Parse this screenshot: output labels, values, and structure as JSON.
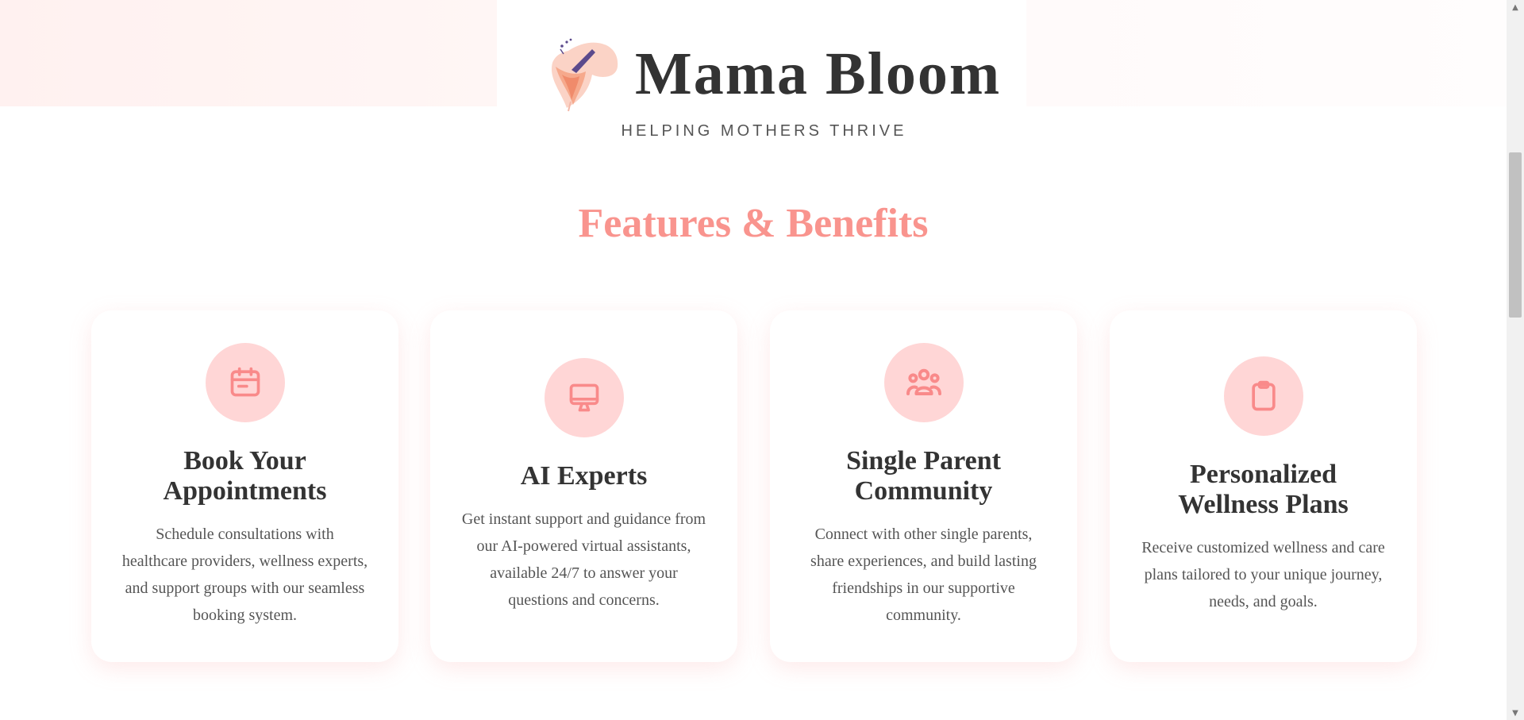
{
  "brand": {
    "title": "Mama Bloom",
    "tagline": "HELPING MOTHERS THRIVE",
    "logo_icon": "flower-logo"
  },
  "features": {
    "title": "Features & Benefits",
    "cards": [
      {
        "icon": "calendar-icon",
        "title": "Book Your Appointments",
        "description": "Schedule consultations with healthcare providers, wellness experts, and support groups with our seamless booking system."
      },
      {
        "icon": "monitor-icon",
        "title": "AI Experts",
        "description": "Get instant support and guidance from our AI-powered virtual assistants, available 24/7 to answer your questions and concerns."
      },
      {
        "icon": "community-icon",
        "title": "Single Parent Community",
        "description": "Connect with other single parents, share experiences, and build lasting friendships in our supportive community."
      },
      {
        "icon": "clipboard-icon",
        "title": "Personalized Wellness Plans",
        "description": "Receive customized wellness and care plans tailored to your unique journey, needs, and goals."
      }
    ]
  },
  "colors": {
    "accent": "#f9948e",
    "icon_bg": "#ffd6d6",
    "icon_stroke": "#f98a8a",
    "heading": "#333333",
    "body_text": "#555555"
  }
}
